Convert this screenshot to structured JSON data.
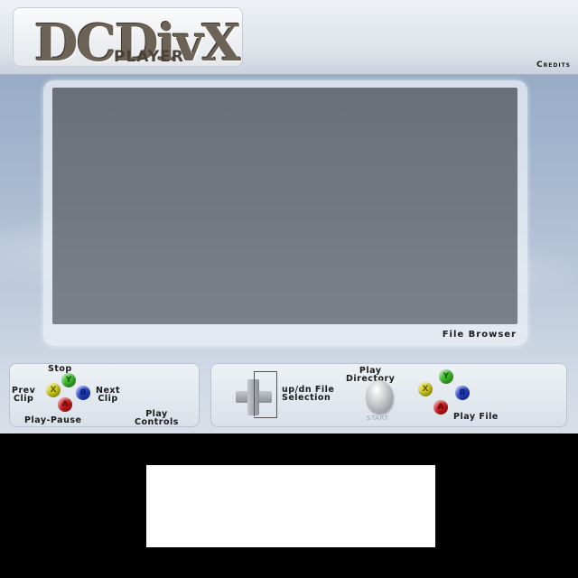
{
  "header": {
    "logo_main": "DCDivX",
    "logo_sub": "PLAYER",
    "credits": "Credits"
  },
  "browser": {
    "label": "File Browser"
  },
  "play_controls": {
    "stop": "Stop",
    "prev_clip": "Prev\nClip",
    "next_clip": "Next\nClip",
    "play_pause": "Play-Pause",
    "title": "Play\nControls",
    "buttons": {
      "top": {
        "glyph": "Y",
        "color": "#3bbf2a"
      },
      "left": {
        "glyph": "X",
        "color": "#d8d21a"
      },
      "right": {
        "glyph": "B",
        "color": "#1f3fd0"
      },
      "bottom": {
        "glyph": "A",
        "color": "#d3181a"
      }
    }
  },
  "file_controls": {
    "updn": "up/dn File\nSelection",
    "play_directory": "Play\nDirectory",
    "start_label": "START",
    "play_file": "Play File"
  },
  "colors": {
    "accent_green": "#3bbf2a",
    "accent_blue": "#1f3fd0",
    "accent_red": "#d3181a",
    "accent_yellow": "#d8d21a"
  }
}
